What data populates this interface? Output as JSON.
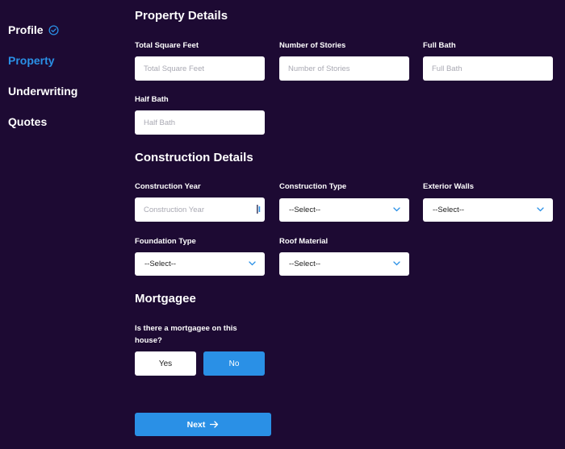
{
  "sidebar": {
    "items": [
      {
        "label": "Profile",
        "completed": true
      },
      {
        "label": "Property",
        "active": true
      },
      {
        "label": "Underwriting"
      },
      {
        "label": "Quotes"
      }
    ]
  },
  "property_details": {
    "title": "Property Details",
    "total_sqft": {
      "label": "Total Square Feet",
      "placeholder": "Total Square Feet"
    },
    "stories": {
      "label": "Number of Stories",
      "placeholder": "Number of Stories"
    },
    "full_bath": {
      "label": "Full Bath",
      "placeholder": "Full Bath"
    },
    "half_bath": {
      "label": "Half Bath",
      "placeholder": "Half Bath"
    }
  },
  "construction_details": {
    "title": "Construction Details",
    "year": {
      "label": "Construction Year",
      "placeholder": "Construction Year"
    },
    "type": {
      "label": "Construction Type",
      "value": "--Select--"
    },
    "exterior_walls": {
      "label": "Exterior Walls",
      "value": "--Select--"
    },
    "foundation_type": {
      "label": "Foundation Type",
      "value": "--Select--"
    },
    "roof_material": {
      "label": "Roof Material",
      "value": "--Select--"
    }
  },
  "mortgagee": {
    "title": "Mortgagee",
    "question": "Is there a mortgagee on this house?",
    "yes_label": "Yes",
    "no_label": "No",
    "selected": "No"
  },
  "next_label": "Next",
  "colors": {
    "background": "#1d0a33",
    "accent": "#2a90e6",
    "input": "#ffffff"
  }
}
